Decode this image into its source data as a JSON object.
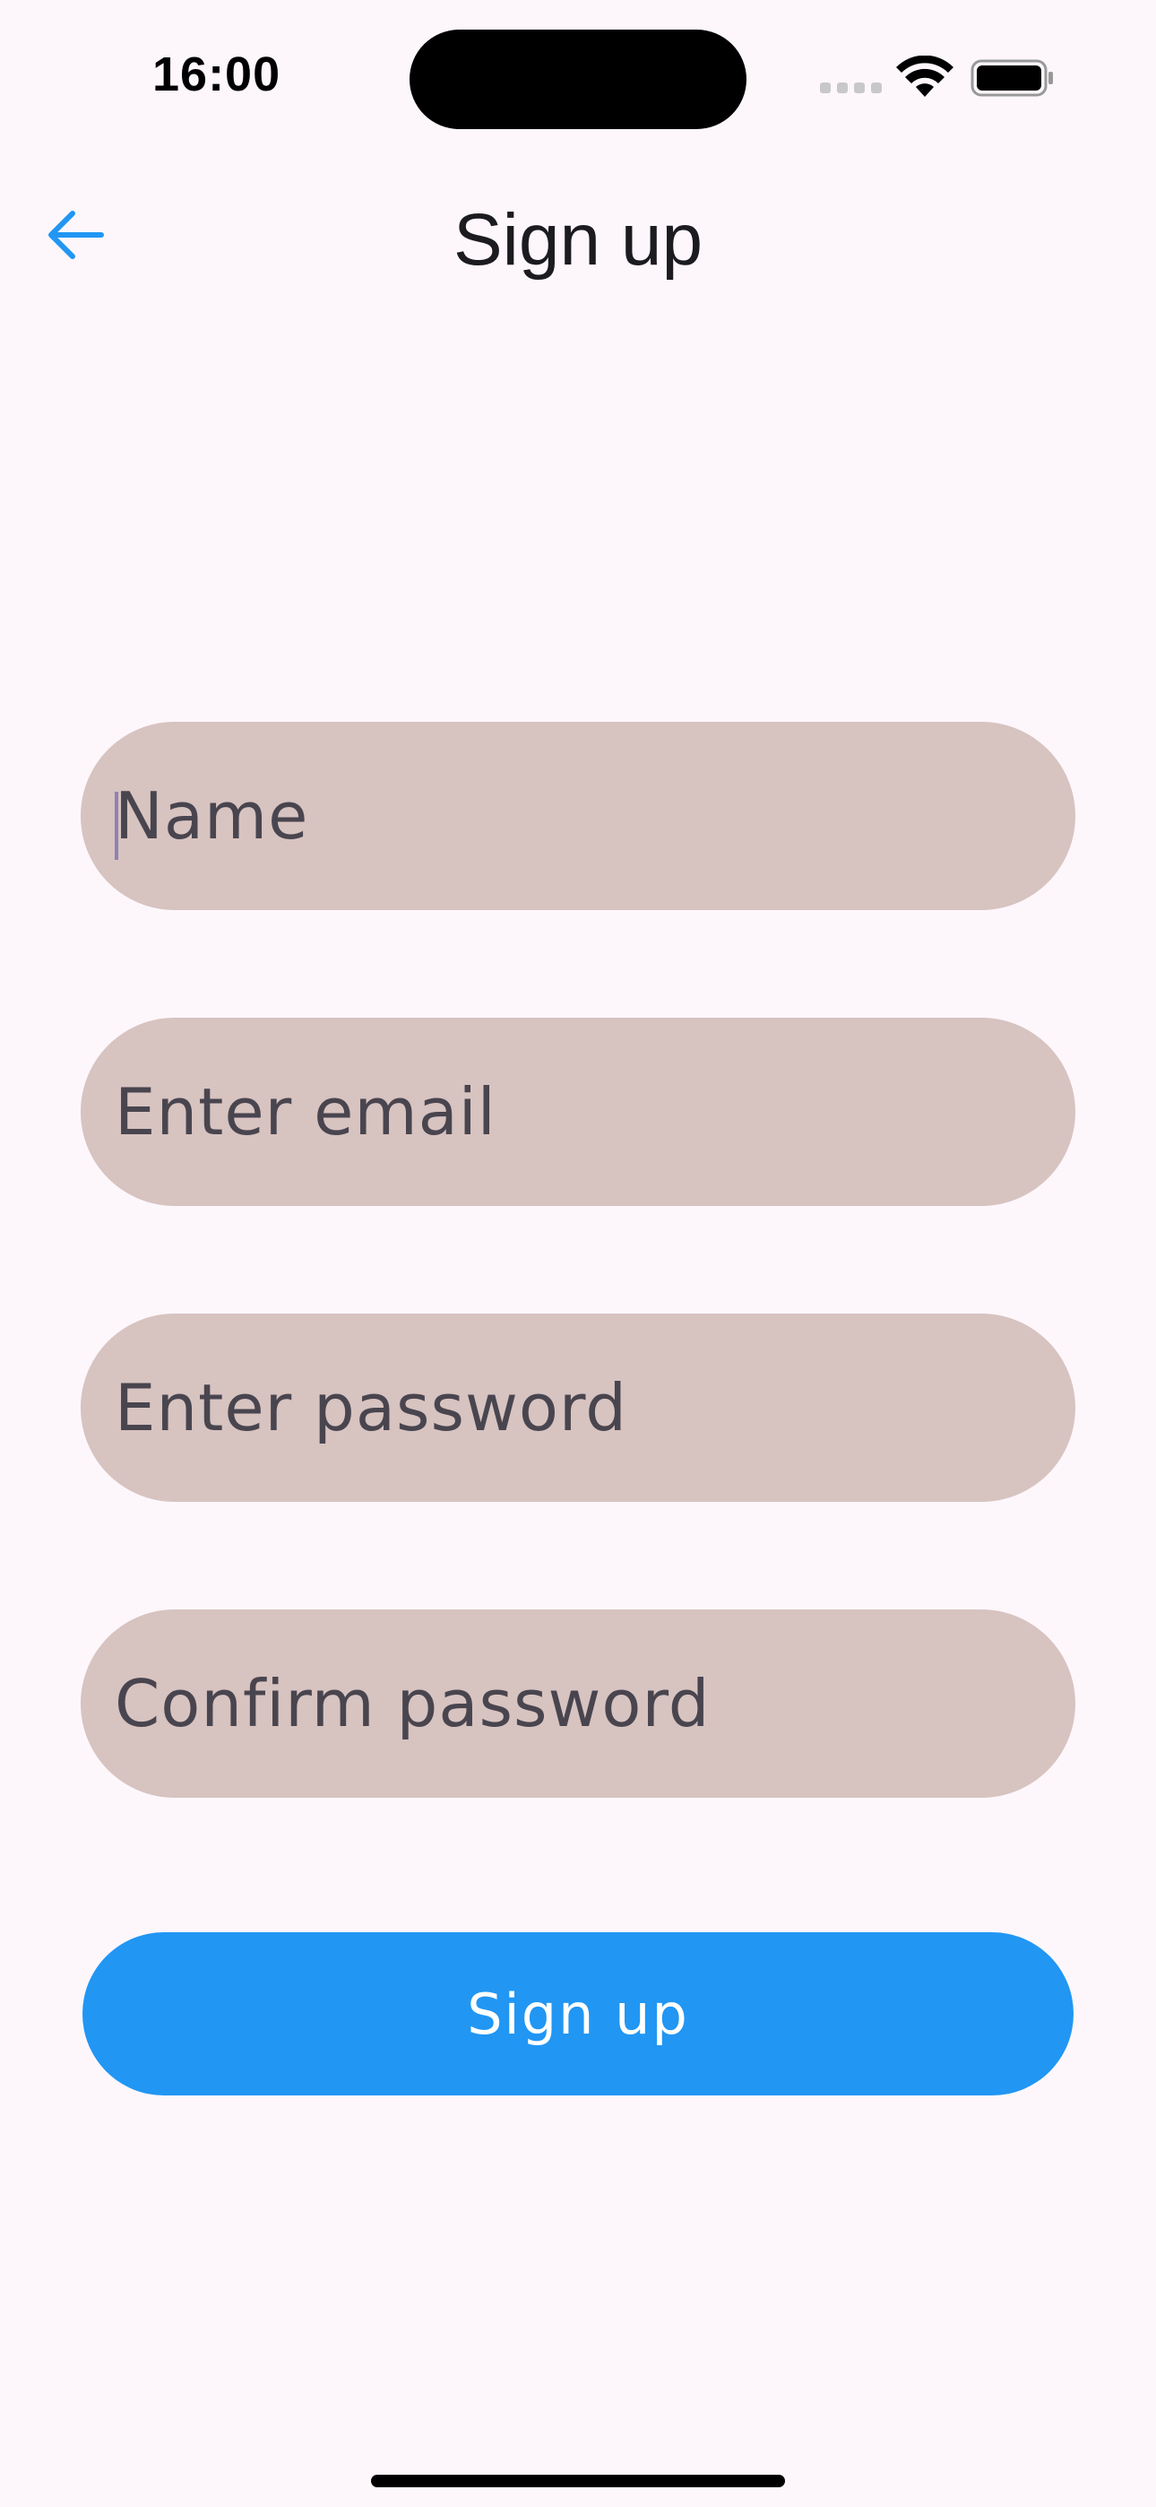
{
  "status_bar": {
    "time": "16:00",
    "icons": [
      "cellular-signal-icon",
      "wifi-icon",
      "battery-icon"
    ]
  },
  "app_bar": {
    "back_icon": "arrow-left-icon",
    "title": "Sign up"
  },
  "form": {
    "name_placeholder": "Name",
    "email_placeholder": "Enter email",
    "password_placeholder": "Enter password",
    "confirm_placeholder": "Confirm password",
    "submit_label": "Sign up"
  },
  "colors": {
    "accent": "#2196F3",
    "field_fill": "#D7C3C0",
    "background": "#FDF7FC",
    "placeholder_text": "#49454F"
  }
}
